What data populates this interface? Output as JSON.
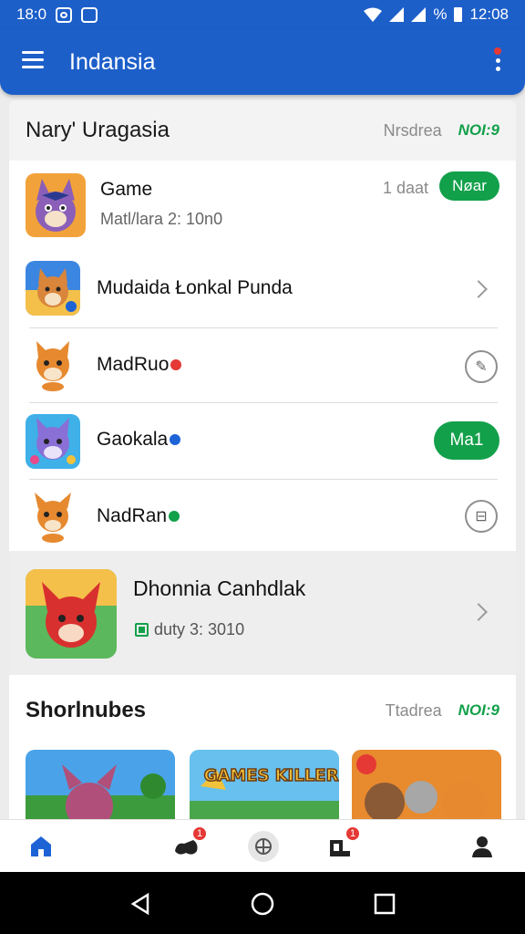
{
  "status_bar": {
    "time_left": "18:0",
    "time_right": "12:08",
    "battery_label": "%"
  },
  "app_bar": {
    "title": "Indansia"
  },
  "section1": {
    "title": "Nary' Uragasia",
    "meta": "Nrsdrea",
    "more": "NOI:9"
  },
  "rows": [
    {
      "title": "Game",
      "subtitle": "Matl/lara 2: 10n0",
      "right_text": "1 daat",
      "action_label": "Nøar",
      "icon": "wolf-hero-icon"
    },
    {
      "title": "Mudaida Łonkal Punda",
      "icon": "fox-character-icon"
    },
    {
      "title": "MadRuo",
      "icon": "fox-cub-icon",
      "badge_color": "#e53935"
    },
    {
      "title": "Gaokala",
      "icon": "purple-wolf-icon",
      "action_label": "Ma1",
      "badge_color": "#1e63d6"
    },
    {
      "title": "NadRan",
      "icon": "fox-cub-icon",
      "badge_color": "#12a04a"
    }
  ],
  "featured": {
    "title": "Dhonnia Canhdlak",
    "subtitle": "duty 3: 3010",
    "icon": "red-wolf-icon"
  },
  "section2": {
    "title": "Shorlnubes",
    "meta": "Ttadrea",
    "more": "NOI:9"
  },
  "thumbnails": [
    {
      "icon": "jungle-creature-thumb"
    },
    {
      "label": "GAMES KILLERS",
      "icon": "games-killers-thumb"
    },
    {
      "icon": "character-group-thumb"
    }
  ],
  "bottom_nav": [
    {
      "icon": "home-icon"
    },
    {
      "icon": "game-controller-icon",
      "badge": "1"
    },
    {
      "icon": "center-action-icon"
    },
    {
      "icon": "inbox-icon",
      "badge": "1"
    },
    {
      "icon": "profile-icon"
    }
  ],
  "colors": {
    "primary": "#1d5fc9",
    "accent_green": "#12a04a",
    "badge_red": "#e53935"
  }
}
